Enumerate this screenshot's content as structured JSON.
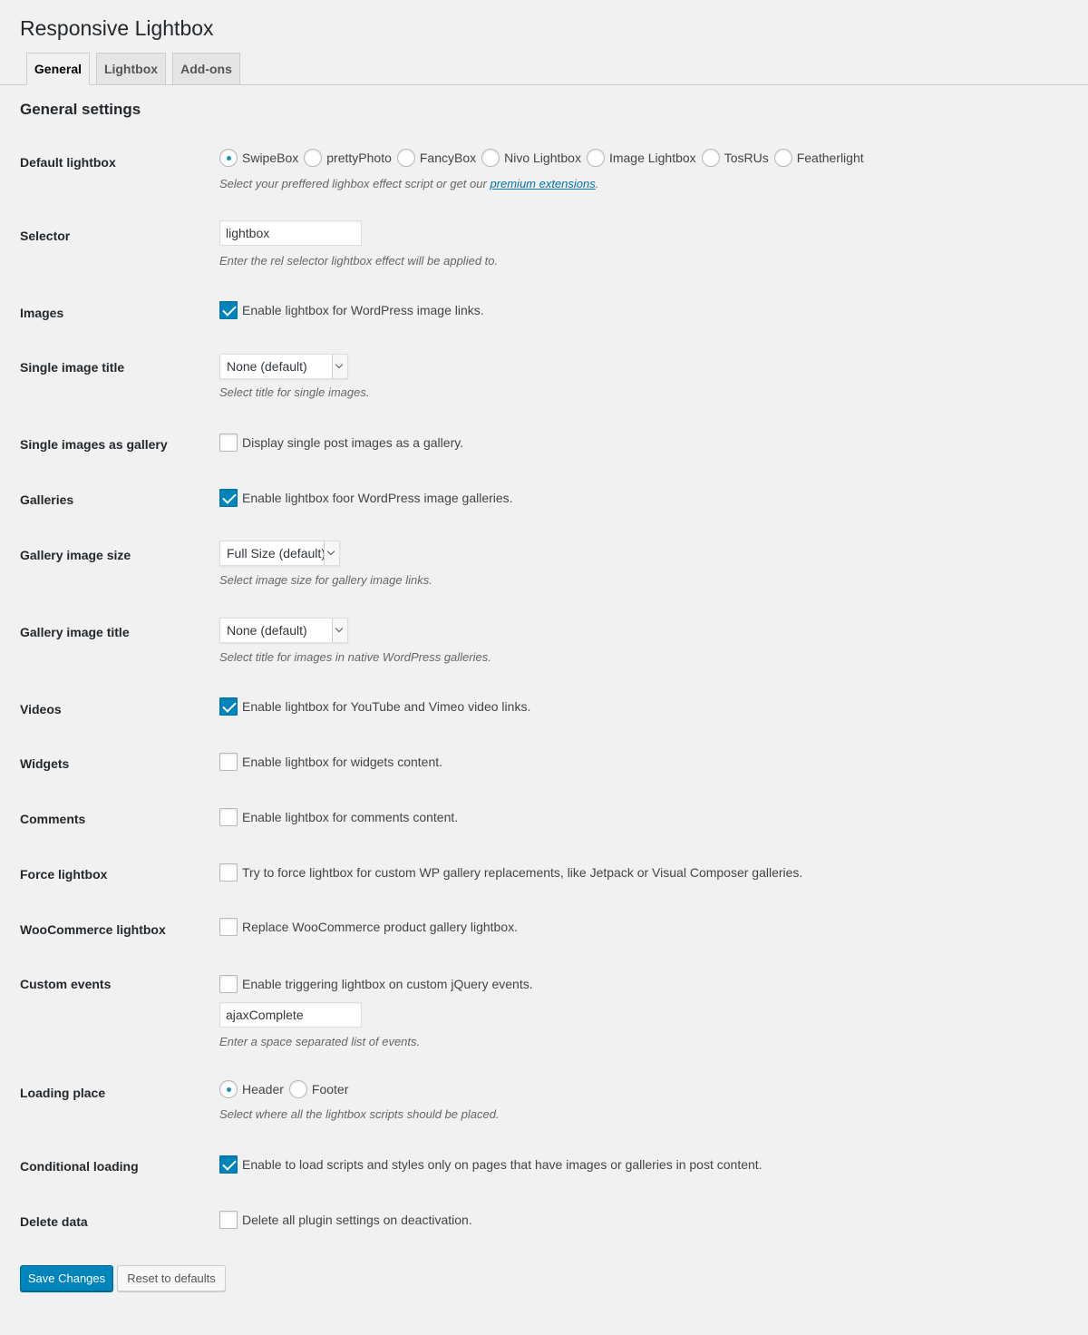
{
  "page": {
    "title": "Responsive Lightbox"
  },
  "tabs": [
    {
      "label": "General"
    },
    {
      "label": "Lightbox"
    },
    {
      "label": "Add-ons"
    }
  ],
  "section": {
    "title": "General settings"
  },
  "default_lightbox": {
    "label": "Default lightbox",
    "options": [
      "SwipeBox",
      "prettyPhoto",
      "FancyBox",
      "Nivo Lightbox",
      "Image Lightbox",
      "TosRUs",
      "Featherlight"
    ],
    "selected": "SwipeBox",
    "desc_prefix": "Select your preffered lighbox effect script or get our ",
    "desc_link": "premium extensions",
    "desc_suffix": "."
  },
  "selector": {
    "label": "Selector",
    "value": "lightbox",
    "desc": "Enter the rel selector lightbox effect will be applied to."
  },
  "images": {
    "label": "Images",
    "text": "Enable lightbox for WordPress image links.",
    "checked": true
  },
  "single_image_title": {
    "label": "Single image title",
    "value": "None (default)",
    "desc": "Select title for single images."
  },
  "single_images_gallery": {
    "label": "Single images as gallery",
    "text": "Display single post images as a gallery.",
    "checked": false
  },
  "galleries": {
    "label": "Galleries",
    "text": "Enable lightbox foor WordPress image galleries.",
    "checked": true
  },
  "gallery_image_size": {
    "label": "Gallery image size",
    "value": "Full Size (default)",
    "desc": "Select image size for gallery image links."
  },
  "gallery_image_title": {
    "label": "Gallery image title",
    "value": "None (default)",
    "desc": "Select title for images in native WordPress galleries."
  },
  "videos": {
    "label": "Videos",
    "text": "Enable lightbox for YouTube and Vimeo video links.",
    "checked": true
  },
  "widgets": {
    "label": "Widgets",
    "text": "Enable lightbox for widgets content.",
    "checked": false
  },
  "comments": {
    "label": "Comments",
    "text": "Enable lightbox for comments content.",
    "checked": false
  },
  "force_lightbox": {
    "label": "Force lightbox",
    "text": "Try to force lightbox for custom WP gallery replacements, like Jetpack or Visual Composer galleries.",
    "checked": false
  },
  "woocommerce": {
    "label": "WooCommerce lightbox",
    "text": "Replace WooCommerce product gallery lightbox.",
    "checked": false
  },
  "custom_events": {
    "label": "Custom events",
    "text": "Enable triggering lightbox on custom jQuery events.",
    "checked": false,
    "value": "ajaxComplete",
    "desc": "Enter a space separated list of events."
  },
  "loading_place": {
    "label": "Loading place",
    "options": [
      "Header",
      "Footer"
    ],
    "selected": "Header",
    "desc": "Select where all the lightbox scripts should be placed."
  },
  "conditional_loading": {
    "label": "Conditional loading",
    "text": "Enable to load scripts and styles only on pages that have images or galleries in post content.",
    "checked": true
  },
  "delete_data": {
    "label": "Delete data",
    "text": "Delete all plugin settings on deactivation.",
    "checked": false
  },
  "buttons": {
    "save": "Save Changes",
    "reset": "Reset to defaults"
  },
  "colors": {
    "primary": "#0085ba",
    "link": "#0073aa",
    "background": "#f1f1f1"
  }
}
